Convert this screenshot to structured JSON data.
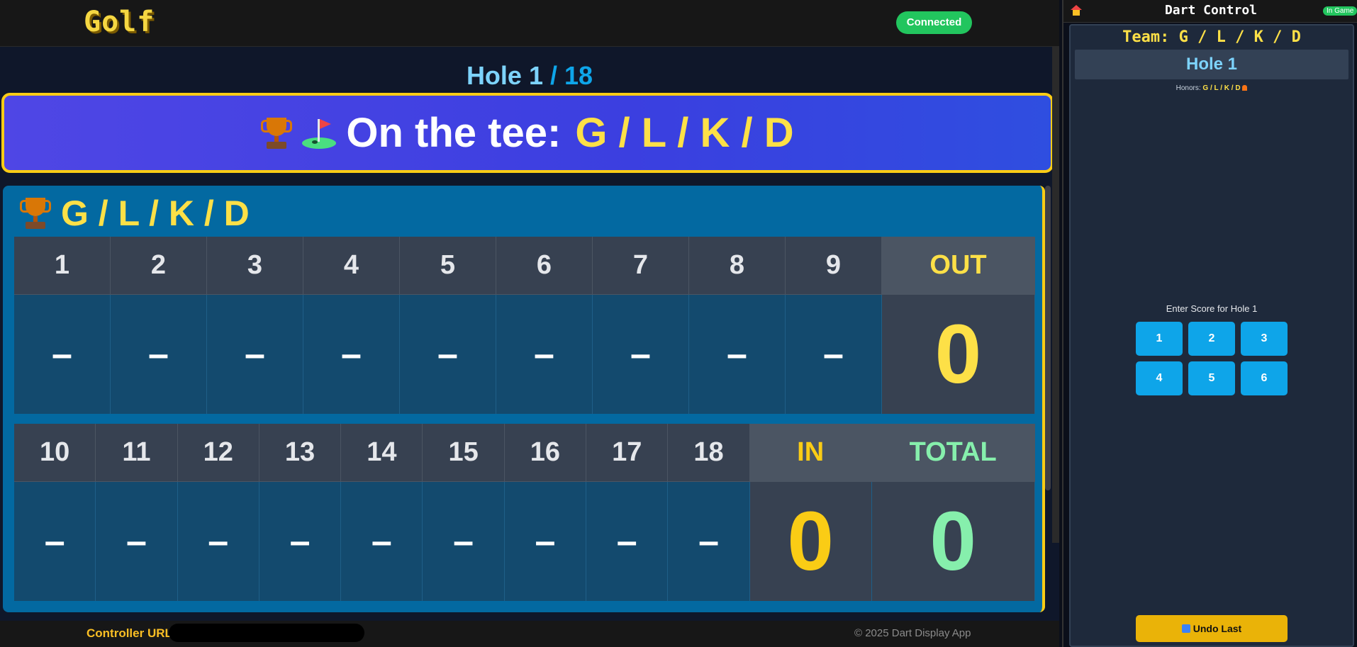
{
  "app": {
    "logo": "Golf",
    "status": "Connected"
  },
  "hole_indicator": {
    "current": "Hole 1",
    "total": " / 18"
  },
  "tee_banner": {
    "label": "On the tee:",
    "team": "G / L / K / D"
  },
  "scorecard": {
    "team": "G / L / K / D",
    "front": {
      "holes": [
        "1",
        "2",
        "3",
        "4",
        "5",
        "6",
        "7",
        "8",
        "9"
      ],
      "scores": [
        "–",
        "–",
        "–",
        "–",
        "–",
        "–",
        "–",
        "–",
        "–"
      ],
      "out_label": "OUT",
      "out_value": "0"
    },
    "back": {
      "holes": [
        "10",
        "11",
        "12",
        "13",
        "14",
        "15",
        "16",
        "17",
        "18"
      ],
      "scores": [
        "–",
        "–",
        "–",
        "–",
        "–",
        "–",
        "–",
        "–",
        "–"
      ],
      "in_label": "IN",
      "in_value": "0",
      "total_label": "TOTAL",
      "total_value": "0"
    }
  },
  "footer": {
    "controller_url_label": "Controller URL",
    "copyright": "© 2025 Dart Display App"
  },
  "side_panel": {
    "title": "Dart Control",
    "badge": "In Game",
    "team": "Team: G / L / K / D",
    "hole": "Hole 1",
    "honors_label": "Honors:",
    "honors_team": "G / L / K / D",
    "enter_score": "Enter Score for Hole 1",
    "keypad": [
      "1",
      "2",
      "3",
      "4",
      "5",
      "6"
    ],
    "undo": "Undo Last"
  },
  "colors": {
    "accent_yellow": "#facc15",
    "sky": "#7dd3fc",
    "banner": "#4f46e5",
    "card": "#0369a1",
    "success": "#22c55e"
  }
}
